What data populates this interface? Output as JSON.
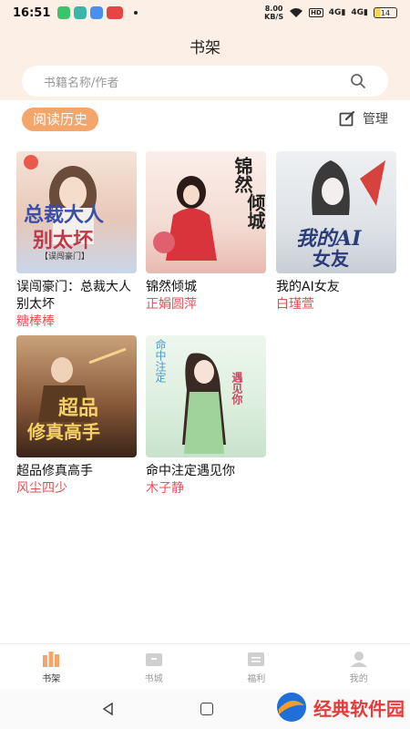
{
  "status": {
    "time": "16:51",
    "speed_value": "8.00",
    "speed_unit": "KB/S",
    "hd": "HD",
    "sig1": "4G",
    "sig2": "4G",
    "battery": "14"
  },
  "header": {
    "title": "书架",
    "search_placeholder": "书籍名称/作者"
  },
  "history": {
    "label": "阅读历史",
    "manage_label": "管理"
  },
  "books": [
    {
      "title": "误闯豪门：总裁大人别太坏",
      "author": "糖棒棒",
      "cover_text_1": "总裁大人",
      "cover_text_2": "别太坏",
      "cover_text_3": "【误闯豪门】"
    },
    {
      "title": "锦然倾城",
      "author": "正娟圆萍",
      "cover_text_1": "锦然",
      "cover_text_2": "倾城"
    },
    {
      "title": "我的AI女友",
      "author": "白瑾萱",
      "cover_text_1": "我的AI",
      "cover_text_2": "女友"
    },
    {
      "title": "超品修真高手",
      "author": "风尘四少",
      "cover_text_1": "超品",
      "cover_text_2": "修真高手"
    },
    {
      "title": "命中注定遇见你",
      "author": "木子静",
      "cover_text_1": "命中注定",
      "cover_text_2": "遇见你"
    }
  ],
  "nav": {
    "items": [
      {
        "label": "书架"
      },
      {
        "label": "书城"
      },
      {
        "label": "福利"
      },
      {
        "label": "我的"
      }
    ]
  },
  "watermark": {
    "text": "经典软件园"
  },
  "colors": {
    "accent": "#f3a56a",
    "author": "#e0515a",
    "header_bg": "#fcf0e6"
  }
}
